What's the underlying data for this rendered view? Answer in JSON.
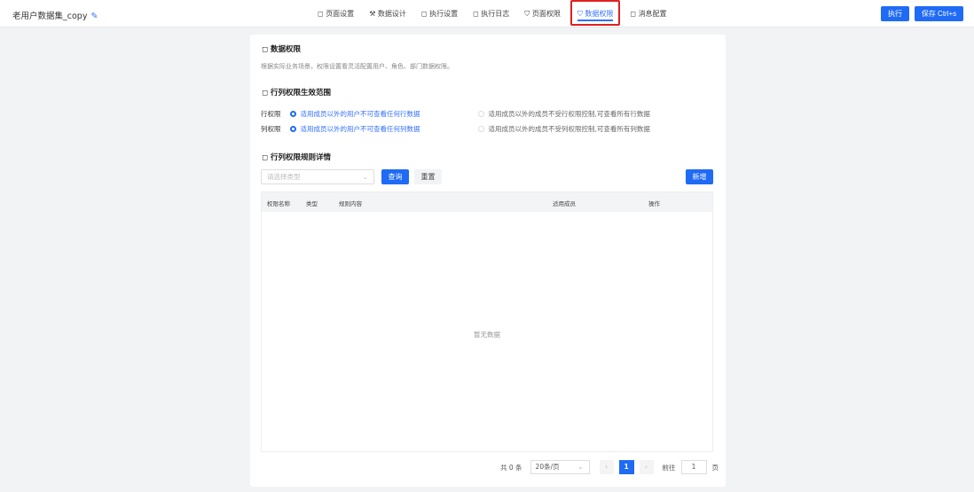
{
  "header": {
    "title": "老用户数据集_copy",
    "tabs": [
      "页面设置",
      "数据设计",
      "执行设置",
      "执行日志",
      "页面权限",
      "数据权限",
      "消息配置"
    ],
    "tab_icons": [
      "◻",
      "⚒",
      "◻",
      "◻",
      "⛉",
      "⛉",
      "◻"
    ],
    "run": "执行",
    "save": "保存 Ctrl+s"
  },
  "section1": {
    "title": "数据权限",
    "desc": "根据实际业务场景，权限设置看灵活配置用户、角色、部门数据权限。"
  },
  "section2": {
    "title": "行列权限生效范围",
    "row_label": "行权限",
    "row_opt1": "适用成员以外的用户不可查看任何行数据",
    "row_opt2": "适用成员以外的成员不受行权限控制,可查看所有行数据",
    "col_label": "列权限",
    "col_opt1": "适用成员以外的用户不可查看任何列数据",
    "col_opt2": "适用成员以外的成员不受列权限控制,可查看所有列数据"
  },
  "section3": {
    "title": "行列权限规则详情",
    "select_placeholder": "请选择类型",
    "query": "查询",
    "reset": "重置",
    "add": "新增",
    "columns": [
      "权限名称",
      "类型",
      "规则内容",
      "适用成员",
      "操作"
    ],
    "empty": "暂无数据"
  },
  "pager": {
    "total": "共 0 条",
    "size": "20条/页",
    "page": "1",
    "goto": "前往",
    "goto_value": "1",
    "page_unit": "页"
  }
}
